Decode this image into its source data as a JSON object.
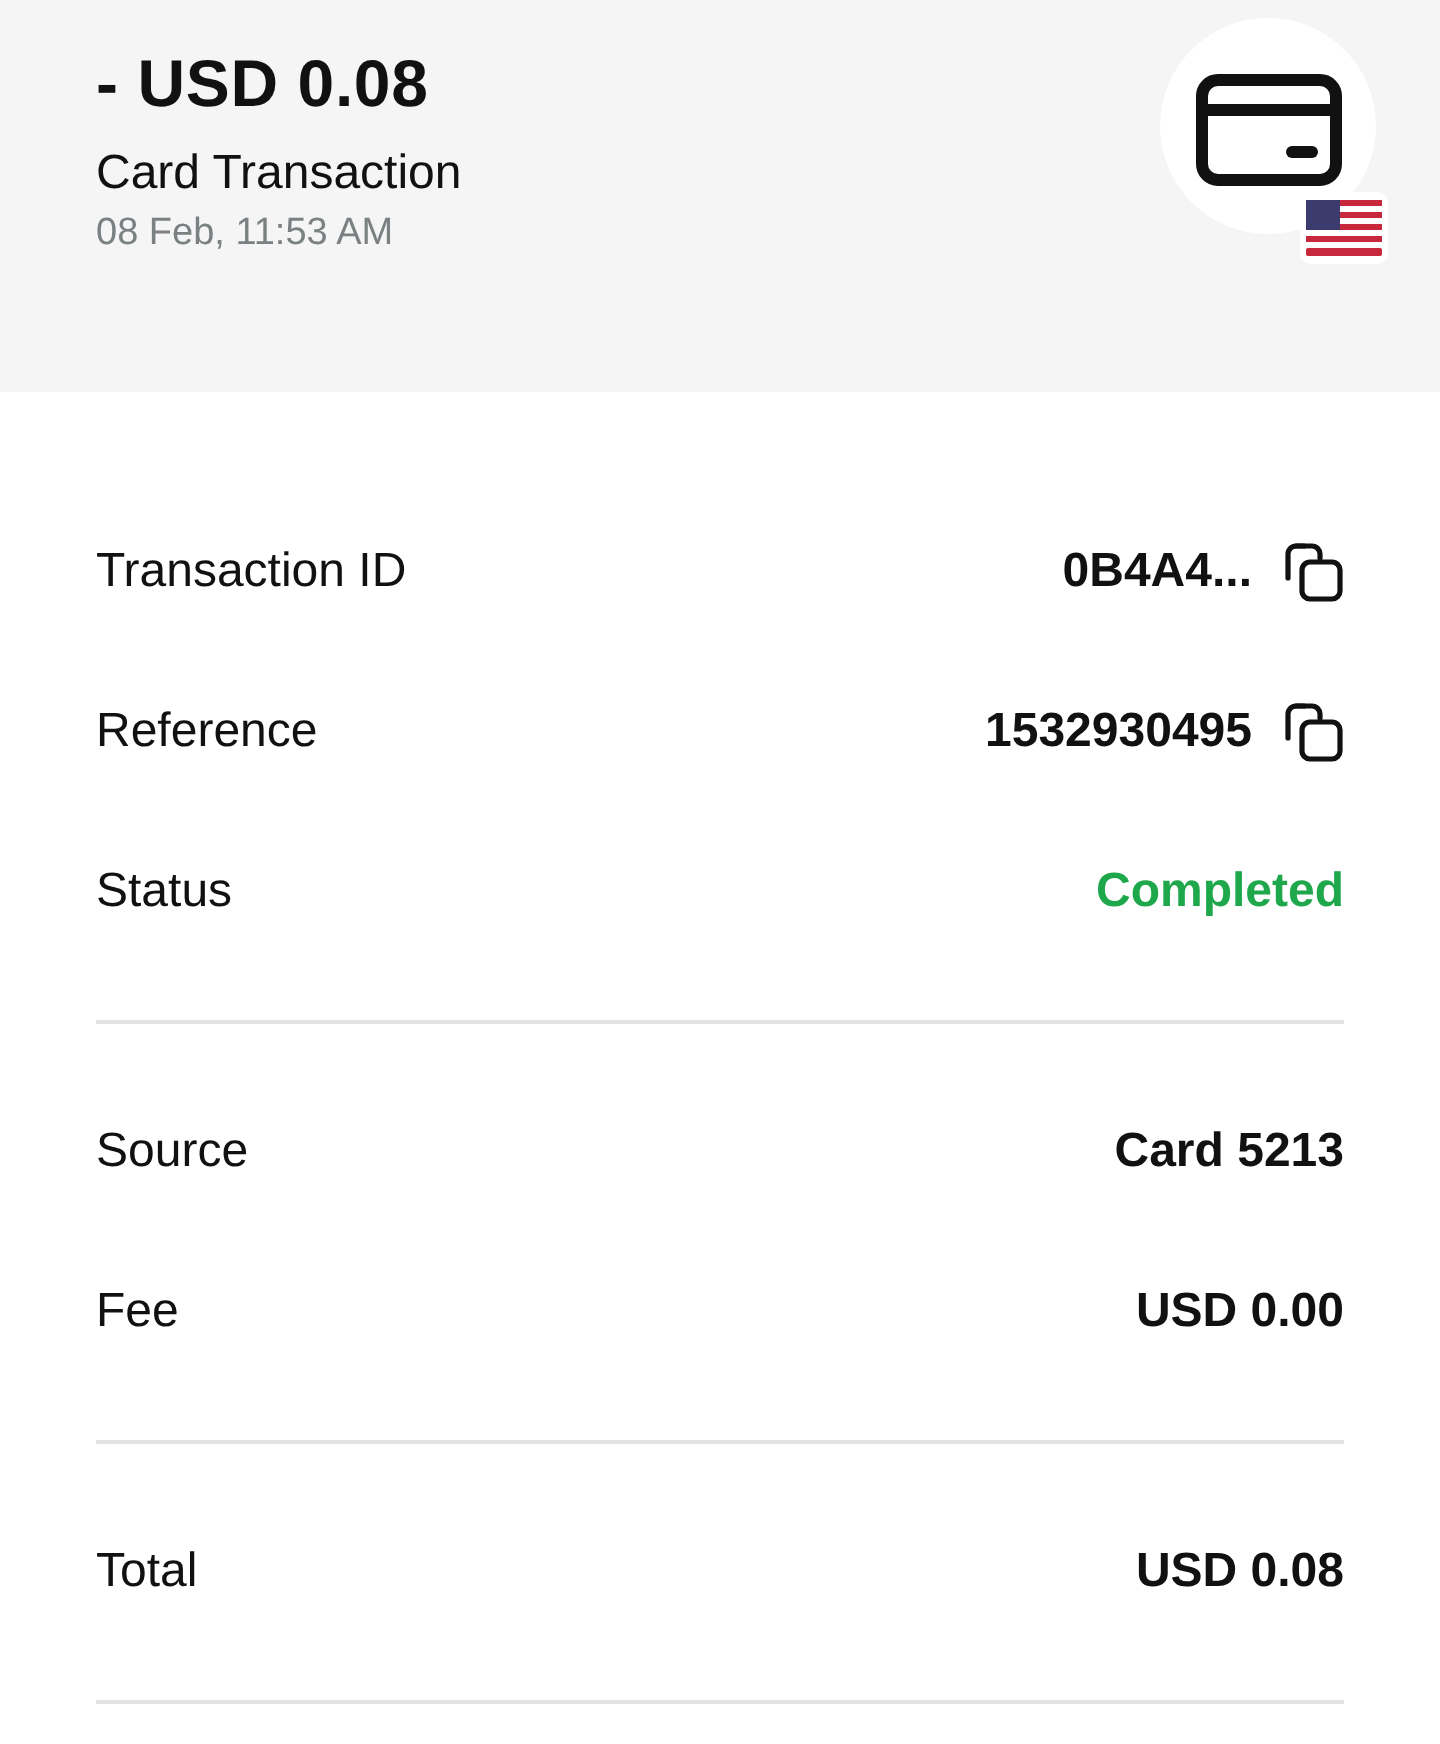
{
  "header": {
    "amount": "- USD 0.08",
    "title": "Card Transaction",
    "date": "08 Feb, 11:53 AM"
  },
  "sections": [
    {
      "rows": [
        {
          "label": "Transaction ID",
          "value": "0B4A4...",
          "kind": "copy"
        },
        {
          "label": "Reference",
          "value": "1532930495",
          "kind": "copy"
        },
        {
          "label": "Status",
          "value": "Completed",
          "kind": "text",
          "color": "#1ea84b"
        }
      ]
    },
    {
      "rows": [
        {
          "label": "Source",
          "value": "Card 5213",
          "kind": "text"
        },
        {
          "label": "Fee",
          "value": "USD 0.00",
          "kind": "text"
        }
      ]
    },
    {
      "rows": [
        {
          "label": "Total",
          "value": "USD 0.08",
          "kind": "text"
        }
      ]
    }
  ]
}
